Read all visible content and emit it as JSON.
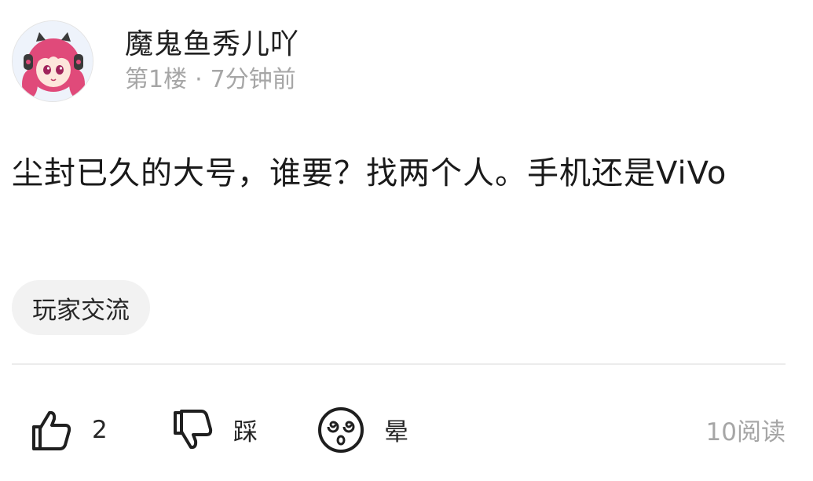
{
  "post": {
    "author": {
      "username": "魔鬼鱼秀儿吖",
      "floor": "第1楼",
      "separator": "·",
      "time": "7分钟前",
      "avatar_icon": "anime-girl-avatar"
    },
    "body_text": "尘封已久的大号，谁要？找两个人。手机还是ViVo",
    "tag": "玩家交流",
    "actions": {
      "like": {
        "icon": "thumbs-up-icon",
        "label": "2"
      },
      "dislike": {
        "icon": "thumbs-down-icon",
        "label": "踩"
      },
      "dizzy": {
        "icon": "dizzy-face-icon",
        "label": "晕"
      }
    },
    "views": "10阅读"
  },
  "colors": {
    "text_primary": "#1a1a1a",
    "text_secondary": "#a6a6a6",
    "tag_bg": "#f2f2f2",
    "divider": "#ececec"
  }
}
